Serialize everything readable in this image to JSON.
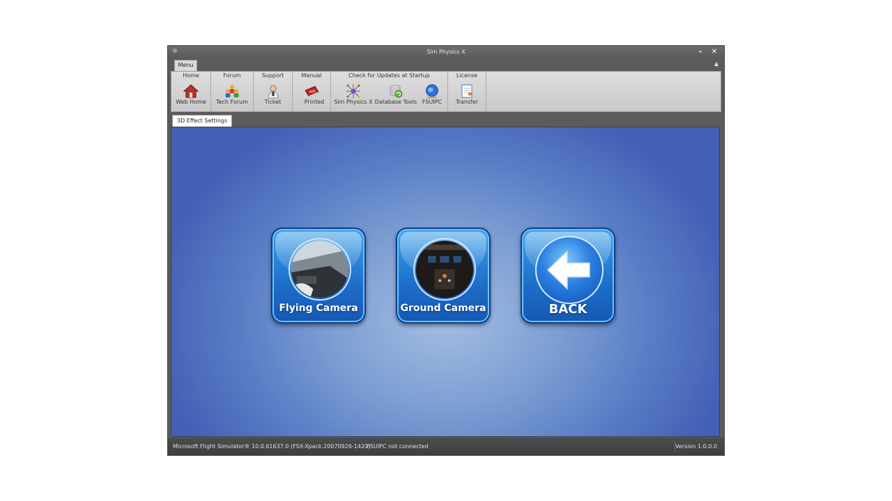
{
  "window": {
    "title": "Sim Physics X"
  },
  "menubar": {
    "menu_tab": "Menu"
  },
  "ribbon": {
    "groups": [
      {
        "label": "Home",
        "buttons": [
          {
            "label": "Web Home",
            "icon": "house-icon"
          }
        ]
      },
      {
        "label": "Forum",
        "buttons": [
          {
            "label": "Tech Forum",
            "icon": "people-icon"
          }
        ]
      },
      {
        "label": "Support",
        "buttons": [
          {
            "label": "Ticket",
            "icon": "support-person-icon"
          }
        ]
      },
      {
        "label": "Manual",
        "buttons": [
          {
            "label": "Printed",
            "icon": "pdf-book-icon"
          }
        ]
      },
      {
        "label": "Check for Updates at Startup",
        "buttons": [
          {
            "label": "Sim Physics X",
            "icon": "network-icon"
          },
          {
            "label": "Database Tools",
            "icon": "database-icon"
          },
          {
            "label": "FSUIPC",
            "icon": "globe-icon"
          }
        ]
      },
      {
        "label": "License",
        "buttons": [
          {
            "label": "Transfer",
            "icon": "license-document-icon"
          }
        ]
      }
    ]
  },
  "tabs": {
    "active": "3D Effect Settings"
  },
  "main": {
    "buttons": [
      {
        "label": "Flying Camera",
        "icon": "cockpit-photo-icon"
      },
      {
        "label": "Ground Camera",
        "icon": "cockpit-panel-photo-icon"
      },
      {
        "label": "BACK",
        "icon": "back-arrow-icon"
      }
    ]
  },
  "status": {
    "simulator": "Microsoft Flight Simulator® 10.0.61637.0 (FSX-Xpack.20070926-1421)",
    "fsuipc": "-  FSUIPC not connected",
    "version": "Version 1.0.0.0"
  },
  "colors": {
    "content_bg": "#5a7ec6",
    "button_blue": "#1d6ec9",
    "chrome_gray": "#5b5b5b"
  }
}
